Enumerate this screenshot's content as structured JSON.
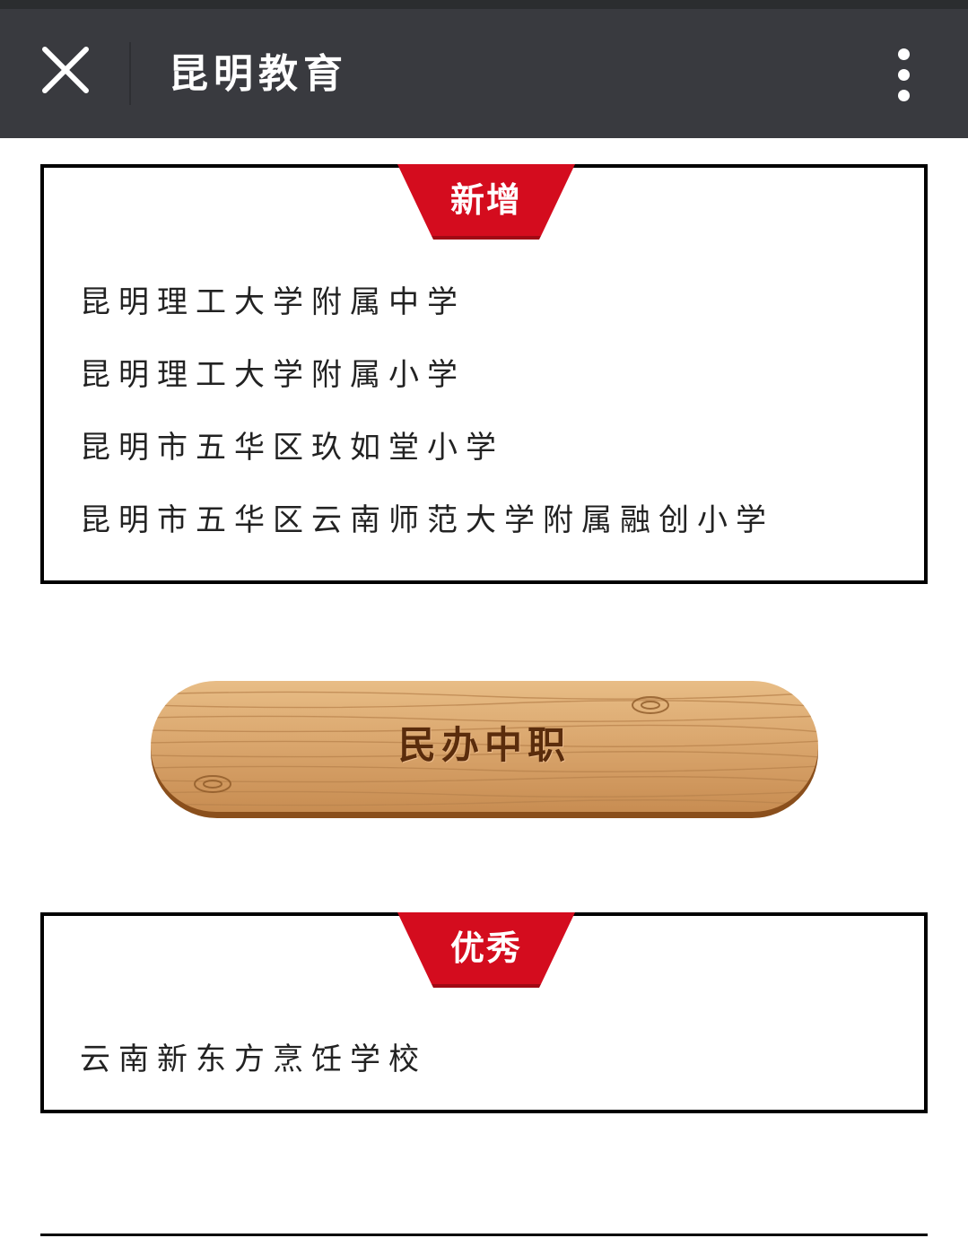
{
  "navbar": {
    "close_icon": "close-icon",
    "title": "昆明教育",
    "more_icon": "more-vertical-icon"
  },
  "sections": {
    "new": {
      "badge": "新增",
      "items": [
        "昆明理工大学附属中学",
        "昆明理工大学附属小学",
        "昆明市五华区玖如堂小学",
        "昆明市五华区云南师范大学附属融创小学"
      ]
    },
    "category_button": {
      "label": "民办中职"
    },
    "best": {
      "badge": "优秀",
      "items": [
        "云南新东方烹饪学校"
      ]
    }
  },
  "colors": {
    "navbar": "#393a3f",
    "badge_red": "#d40c1e",
    "wood": "#d9a56c",
    "wood_text": "#5a2c0c"
  }
}
